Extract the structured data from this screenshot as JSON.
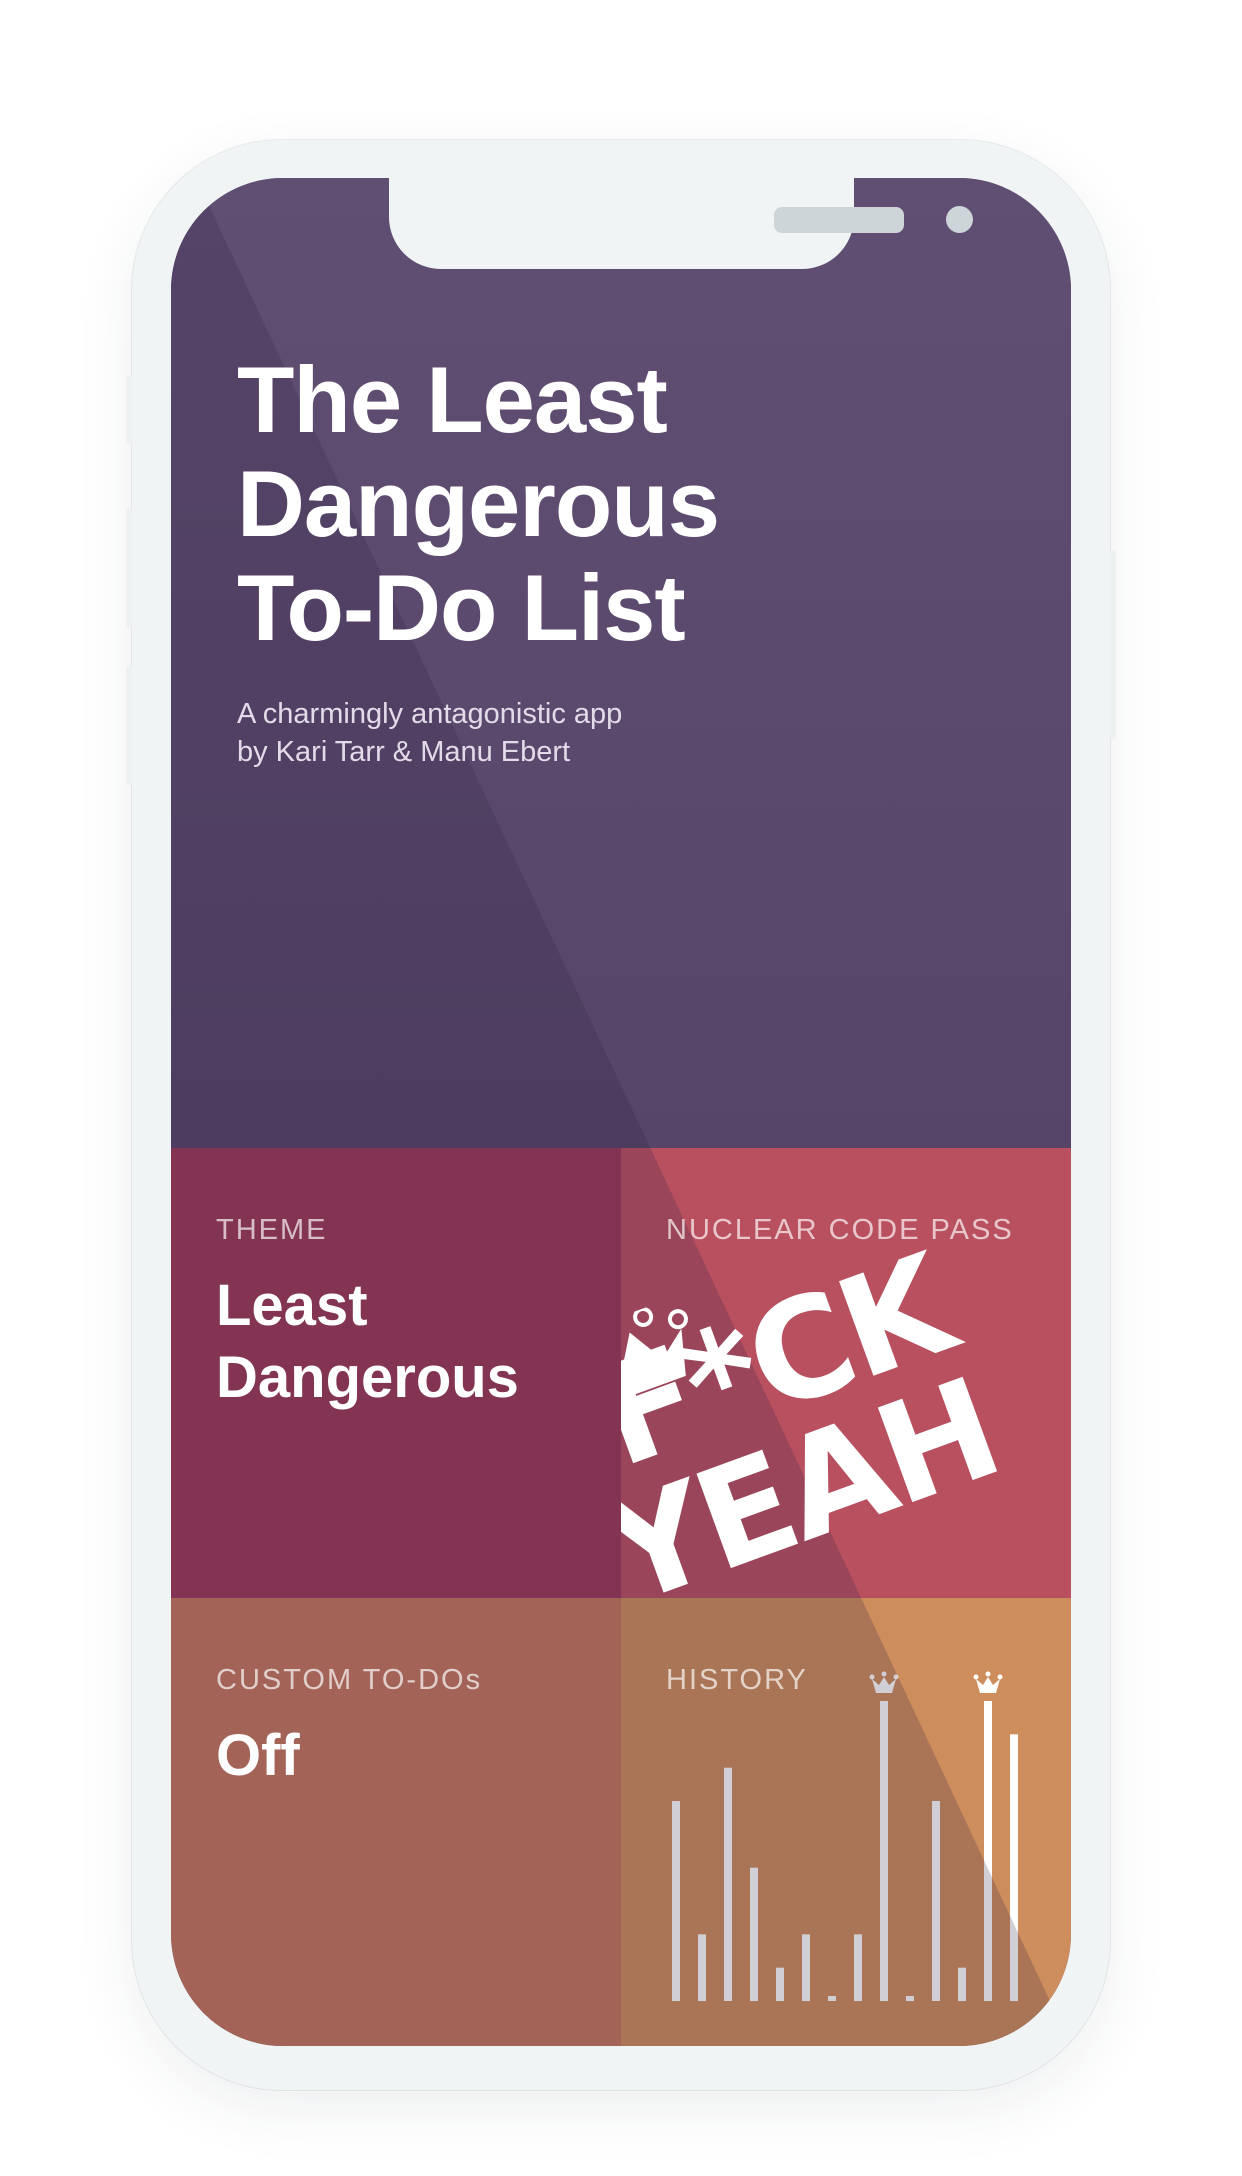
{
  "app": {
    "title_lines": [
      "The Least",
      "Dangerous",
      "To-Do List"
    ],
    "subtitle_lines": [
      "A charmingly antagonistic app",
      "by Kari Tarr & Manu Ebert"
    ]
  },
  "tiles": {
    "theme": {
      "label": "THEME",
      "value_lines": [
        "Least",
        "Dangerous"
      ]
    },
    "pass": {
      "label": "NUCLEAR CODE PASS",
      "stamp_lines": [
        "F*CK",
        "YEAH"
      ],
      "icon": "crown-icon"
    },
    "custom": {
      "label": "CUSTOM TO-DOs",
      "value": "Off"
    },
    "history": {
      "label": "HISTORY",
      "bar_values": [
        6,
        2,
        7,
        4,
        1,
        2,
        0,
        2,
        9,
        0,
        6,
        1,
        9,
        8
      ],
      "crowned_bars": [
        8,
        12
      ],
      "bar_color": "#ffffff"
    }
  },
  "colors": {
    "hero": "#5c4a6e",
    "theme_tile": "#9a3a58",
    "pass_tile": "#b95060",
    "custom_tile": "#c4775e",
    "history_tile": "#ce8d5d",
    "device_frame": "#f1f4f5"
  }
}
